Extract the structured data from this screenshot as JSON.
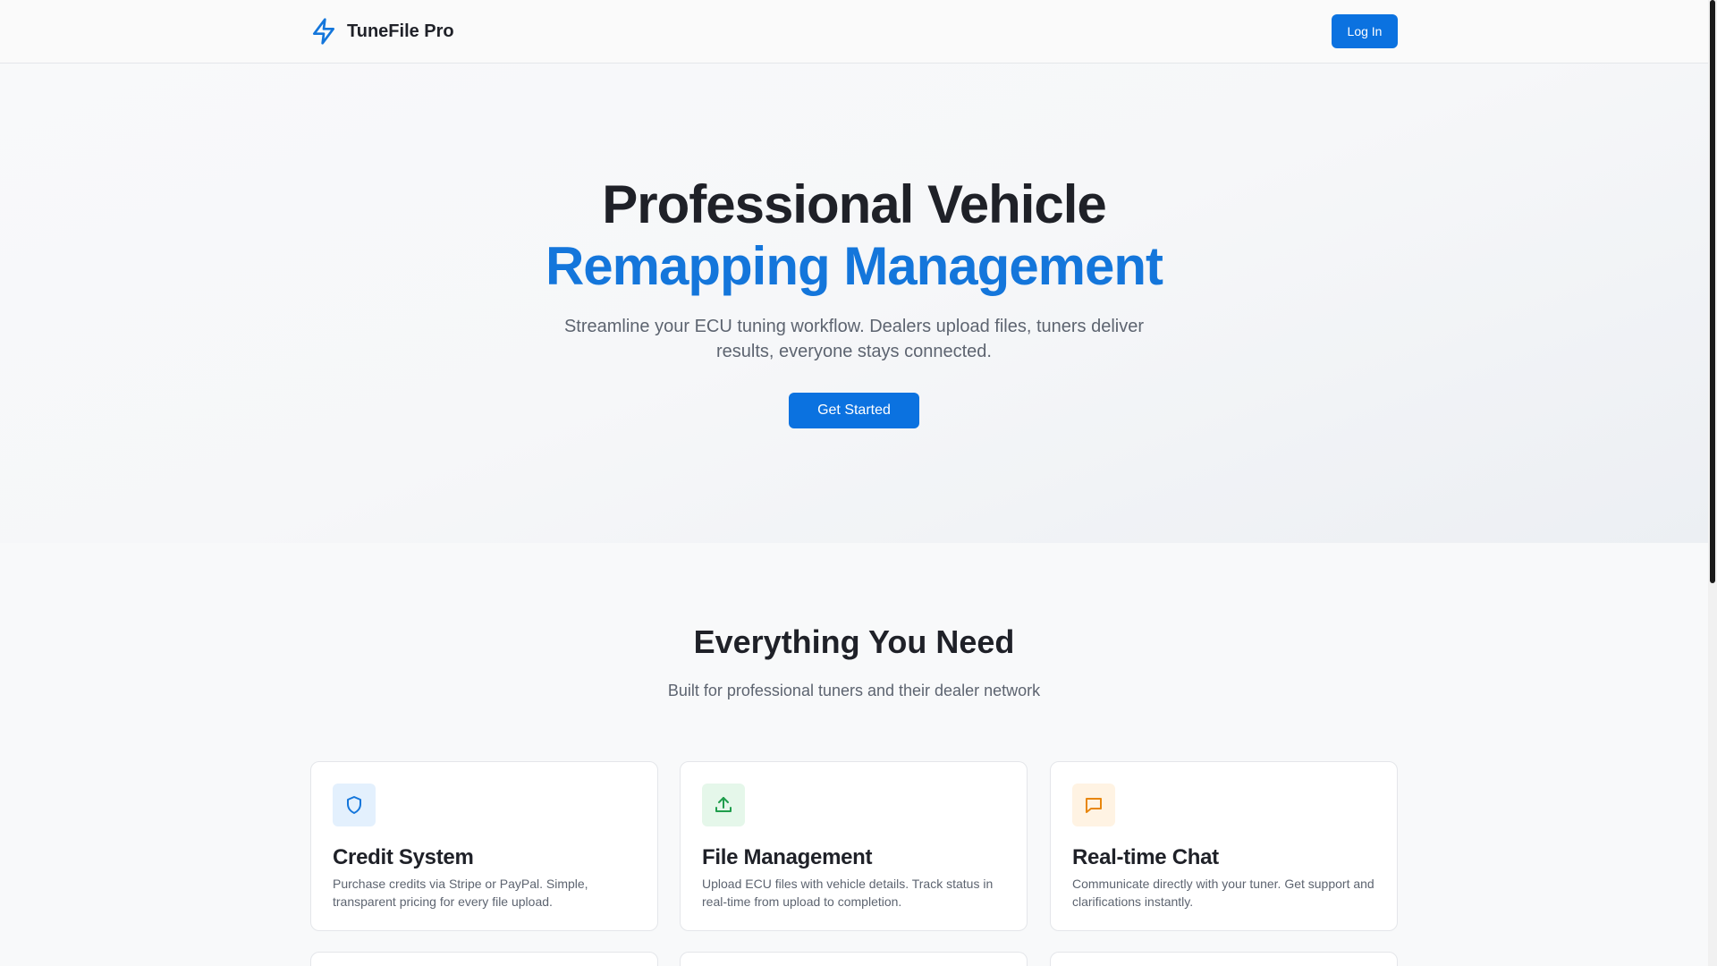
{
  "header": {
    "brand_name": "TuneFile Pro",
    "brand_icon": "lightning-bolt-icon",
    "login_label": "Log In"
  },
  "hero": {
    "title_line1": "Professional Vehicle",
    "title_line2": "Remapping Management",
    "subtitle": "Streamline your ECU tuning workflow. Dealers upload files, tuners deliver results, everyone stays connected.",
    "cta_label": "Get Started"
  },
  "features": {
    "title": "Everything You Need",
    "subtitle": "Built for professional tuners and their dealer network",
    "cards": [
      {
        "icon": "shield-icon",
        "title": "Credit System",
        "description": "Purchase credits via Stripe or PayPal. Simple, transparent pricing for every file upload.",
        "icon_bg": "#e3f0fd",
        "icon_color": "#1476db"
      },
      {
        "icon": "upload-icon",
        "title": "File Management",
        "description": "Upload ECU files with vehicle details. Track status in real-time from upload to completion.",
        "icon_bg": "#e5f7ea",
        "icon_color": "#1f9d4c"
      },
      {
        "icon": "chat-bubble-icon",
        "title": "Real-time Chat",
        "description": "Communicate directly with your tuner. Get support and clarifications instantly.",
        "icon_bg": "#fff3e3",
        "icon_color": "#e8860c"
      }
    ]
  },
  "colors": {
    "accent": "#0b72e0",
    "heading_accent": "#1476db"
  }
}
